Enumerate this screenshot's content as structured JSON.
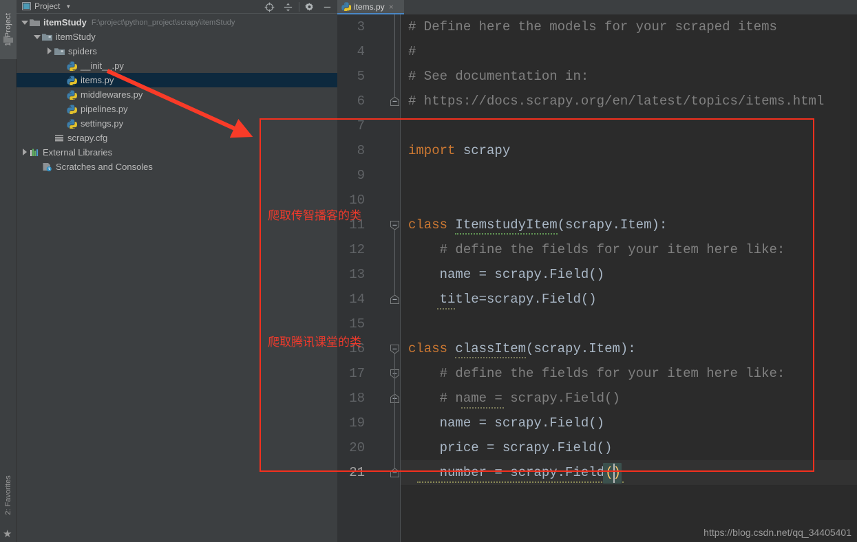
{
  "rail": {
    "project_button": "1: Project",
    "favorites_button": "2: Favorites",
    "folder_icon": "folder-icon",
    "star_icon": "star-icon"
  },
  "project_panel": {
    "title": "Project",
    "caret": "▼",
    "toolbar": {
      "locate_icon": "locate-target-icon",
      "collapse_icon": "collapse-all-icon",
      "gear_icon": "gear-icon",
      "minimize_icon": "minimize-icon",
      "minimize_label": "—"
    },
    "tree": [
      {
        "label": "itemStudy",
        "path": "F:\\project\\python_project\\scrapy\\itemStudy",
        "icon": "folder-icon",
        "arrow": "down",
        "indent": 0,
        "bold": true,
        "selected": false
      },
      {
        "label": "itemStudy",
        "path": "",
        "icon": "module-folder-icon",
        "arrow": "down",
        "indent": 1,
        "bold": false,
        "selected": false
      },
      {
        "label": "spiders",
        "path": "",
        "icon": "module-folder-icon",
        "arrow": "right",
        "indent": 2,
        "bold": false,
        "selected": false
      },
      {
        "label": "__init__.py",
        "path": "",
        "icon": "python-file-icon",
        "arrow": "none",
        "indent": 3,
        "bold": false,
        "selected": false
      },
      {
        "label": "items.py",
        "path": "",
        "icon": "python-file-icon",
        "arrow": "none",
        "indent": 3,
        "bold": false,
        "selected": true
      },
      {
        "label": "middlewares.py",
        "path": "",
        "icon": "python-file-icon",
        "arrow": "none",
        "indent": 3,
        "bold": false,
        "selected": false
      },
      {
        "label": "pipelines.py",
        "path": "",
        "icon": "python-file-icon",
        "arrow": "none",
        "indent": 3,
        "bold": false,
        "selected": false
      },
      {
        "label": "settings.py",
        "path": "",
        "icon": "python-file-icon",
        "arrow": "none",
        "indent": 3,
        "bold": false,
        "selected": false
      },
      {
        "label": "scrapy.cfg",
        "path": "",
        "icon": "config-file-icon",
        "arrow": "none",
        "indent": 2,
        "bold": false,
        "selected": false
      },
      {
        "label": "External Libraries",
        "path": "",
        "icon": "libraries-icon",
        "arrow": "right",
        "indent": 0,
        "bold": false,
        "selected": false
      },
      {
        "label": "Scratches and Consoles",
        "path": "",
        "icon": "scratches-icon",
        "arrow": "none",
        "indent": 1,
        "bold": false,
        "selected": false
      }
    ]
  },
  "editor": {
    "tab": {
      "label": "items.py",
      "icon": "python-file-icon",
      "close": "×"
    },
    "first_visible_line": 3,
    "current_line": 21,
    "lines": [
      {
        "n": 3,
        "text": "# Define here the models for your scraped items",
        "kind": "comment",
        "fold": "none"
      },
      {
        "n": 4,
        "text": "#",
        "kind": "comment",
        "fold": "none"
      },
      {
        "n": 5,
        "text": "# See documentation in:",
        "kind": "comment",
        "fold": "none"
      },
      {
        "n": 6,
        "text": "# https://docs.scrapy.org/en/latest/topics/items.html",
        "kind": "comment",
        "fold": "end"
      },
      {
        "n": 7,
        "text": "",
        "kind": "blank",
        "fold": "none"
      },
      {
        "n": 8,
        "text": "import scrapy",
        "kind": "import",
        "fold": "none"
      },
      {
        "n": 9,
        "text": "",
        "kind": "blank",
        "fold": "none"
      },
      {
        "n": 10,
        "text": "",
        "kind": "blank",
        "fold": "none"
      },
      {
        "n": 11,
        "text": "class ItemstudyItem(scrapy.Item):",
        "kind": "class",
        "fold": "start"
      },
      {
        "n": 12,
        "text": "    # define the fields for your item here like:",
        "kind": "comment",
        "fold": "none"
      },
      {
        "n": 13,
        "text": "    name = scrapy.Field()",
        "kind": "code",
        "fold": "none"
      },
      {
        "n": 14,
        "text": "    title=scrapy.Field()",
        "kind": "code",
        "fold": "end"
      },
      {
        "n": 15,
        "text": "",
        "kind": "blank",
        "fold": "none"
      },
      {
        "n": 16,
        "text": "class classItem(scrapy.Item):",
        "kind": "class",
        "fold": "start"
      },
      {
        "n": 17,
        "text": "    # define the fields for your item here like:",
        "kind": "comment",
        "fold": "start"
      },
      {
        "n": 18,
        "text": "    # name = scrapy.Field()",
        "kind": "comment",
        "fold": "end"
      },
      {
        "n": 19,
        "text": "    name = scrapy.Field()",
        "kind": "code",
        "fold": "none"
      },
      {
        "n": 20,
        "text": "    price = scrapy.Field()",
        "kind": "code",
        "fold": "none"
      },
      {
        "n": 21,
        "text": "    number = scrapy.Field()",
        "kind": "code",
        "fold": "end"
      }
    ]
  },
  "annotations": {
    "note_1": "爬取传智播客的类",
    "note_2": "爬取腾讯课堂的类",
    "highlight_rect_color": "#f4301e",
    "arrow_color": "#f93b28"
  },
  "watermark": "https://blog.csdn.net/qq_34405401"
}
